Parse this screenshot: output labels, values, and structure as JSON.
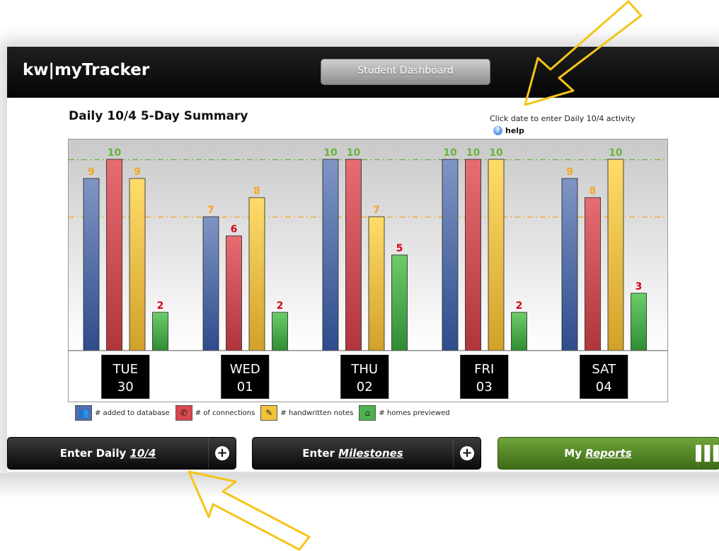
{
  "app": {
    "logo": "kw|myTracker",
    "dashboard_button": "Student Dashboard"
  },
  "summary": {
    "title": "Daily 10/4 5-Day Summary",
    "hint": "Click date to enter Daily 10/4 activity",
    "help": "help"
  },
  "chart_data": {
    "type": "bar",
    "categories": [
      "TUE 30",
      "WED 01",
      "THU 02",
      "FRI 03",
      "SAT 04"
    ],
    "days": [
      {
        "dow": "TUE",
        "num": "30"
      },
      {
        "dow": "WED",
        "num": "01"
      },
      {
        "dow": "THU",
        "num": "02"
      },
      {
        "dow": "FRI",
        "num": "03"
      },
      {
        "dow": "SAT",
        "num": "04"
      }
    ],
    "series": [
      {
        "name": "# added to database",
        "values": [
          9,
          7,
          10,
          10,
          9
        ],
        "color": "#4f6fae",
        "label_color": "#f5a623"
      },
      {
        "name": "# of connections",
        "values": [
          10,
          6,
          10,
          10,
          8
        ],
        "color": "#d9474f",
        "label_color": "#6bb33a"
      },
      {
        "name": "# handwritten notes",
        "values": [
          9,
          8,
          7,
          10,
          10
        ],
        "color": "#f3c43a",
        "label_color": "#f5a623"
      },
      {
        "name": "# homes previewed",
        "values": [
          2,
          2,
          5,
          2,
          3
        ],
        "color": "#4eb24e",
        "label_color": "#d0021b"
      }
    ],
    "label_colors_by_value": {
      "10": "#6bb33a",
      "2": "#d0021b",
      "3": "#d0021b",
      "5": "#d0021b",
      "6": "#d0021b",
      "7": "#f5a623",
      "8": "#f5a623",
      "9": "#f5a623"
    },
    "reference_lines": [
      {
        "value": 10,
        "color": "#6bb33a"
      },
      {
        "value": 7,
        "color": "#f5a623"
      }
    ],
    "ylim": [
      0,
      11
    ],
    "grid": false
  },
  "legend": [
    {
      "label": "# added to database",
      "icon": "people-icon",
      "color": "#4f6fae"
    },
    {
      "label": "# of connections",
      "icon": "phone-icon",
      "color": "#d9474f"
    },
    {
      "label": "# handwritten notes",
      "icon": "pen-icon",
      "color": "#f3c43a"
    },
    {
      "label": "# homes previewed",
      "icon": "home-icon",
      "color": "#4eb24e"
    }
  ],
  "actions": {
    "daily": {
      "prefix": "Enter Daily ",
      "link": "10/4"
    },
    "milestones": {
      "prefix": "Enter ",
      "link": "Milestones"
    },
    "reports": {
      "prefix": "My ",
      "link": "Reports"
    }
  },
  "annotations": {
    "arrow_color": "#f5c518"
  }
}
